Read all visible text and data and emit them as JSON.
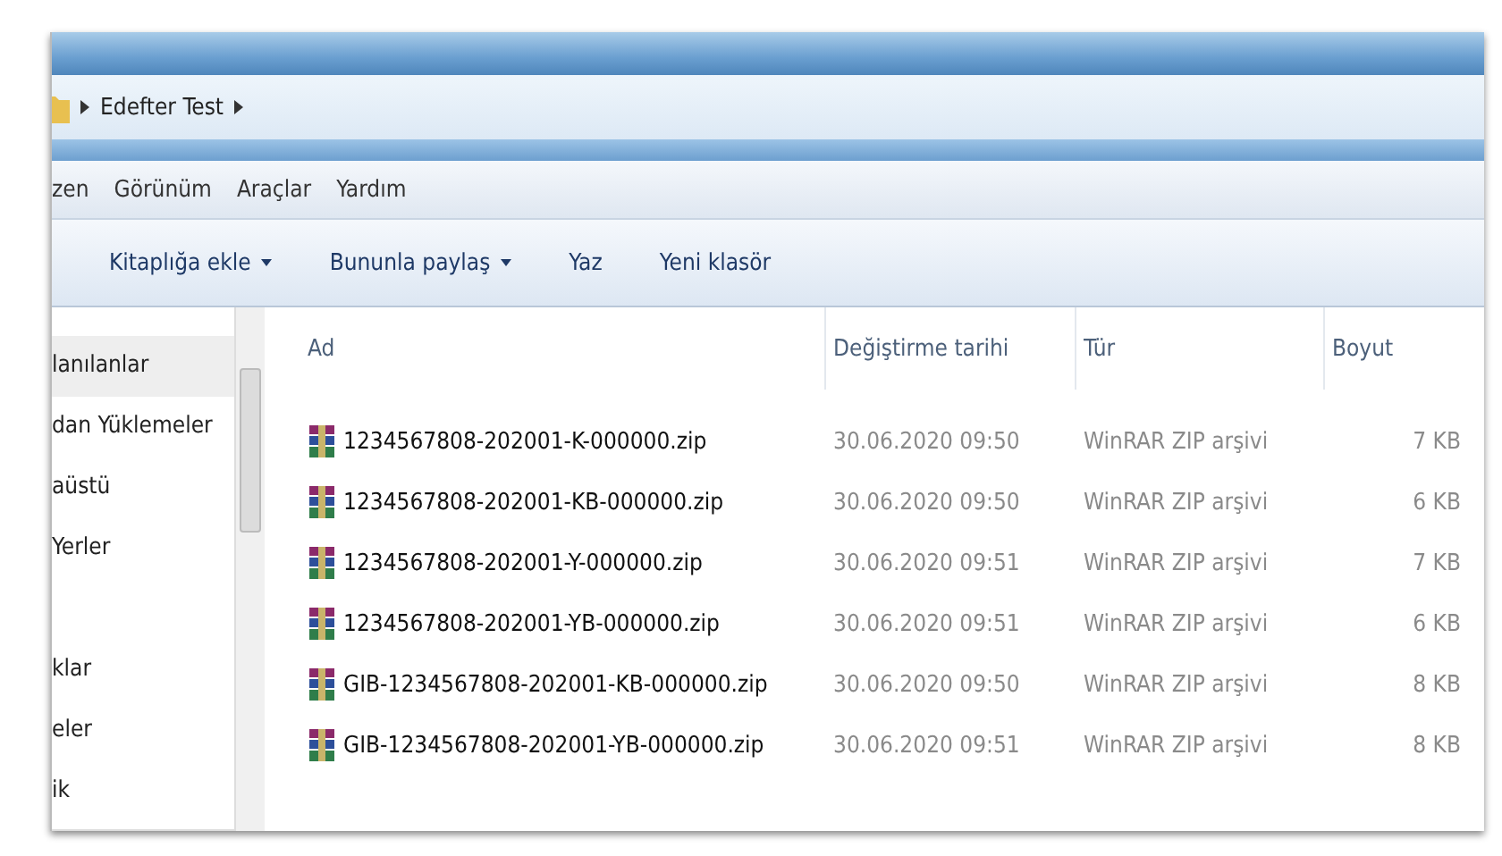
{
  "address_bar": {
    "path": [
      "Edefter Test"
    ]
  },
  "menu_bar": [
    "zen",
    "Görünüm",
    "Araçlar",
    "Yardım"
  ],
  "toolbar": [
    {
      "label": "Kitaplığa ekle",
      "dropdown": true
    },
    {
      "label": "Bununla paylaş",
      "dropdown": true
    },
    {
      "label": "Yaz",
      "dropdown": false
    },
    {
      "label": "Yeni klasör",
      "dropdown": false
    }
  ],
  "sidebar": {
    "groups": [
      {
        "items": [
          {
            "label": "lanılanlar",
            "selected": true
          },
          {
            "label": "dan Yüklemeler",
            "selected": false
          },
          {
            "label": "aüstü",
            "selected": false
          },
          {
            "label": "Yerler",
            "selected": false
          }
        ]
      },
      {
        "items": [
          {
            "label": "klar",
            "selected": false
          },
          {
            "label": "eler",
            "selected": false
          },
          {
            "label": "ik",
            "selected": false
          }
        ]
      }
    ]
  },
  "table": {
    "columns": [
      "Ad",
      "Değiştirme tarihi",
      "Tür",
      "Boyut"
    ],
    "rows": [
      {
        "name": "1234567808-202001-K-000000.zip",
        "modified": "30.06.2020 09:50",
        "type": "WinRAR ZIP arşivi",
        "size": "7 KB"
      },
      {
        "name": "1234567808-202001-KB-000000.zip",
        "modified": "30.06.2020 09:50",
        "type": "WinRAR ZIP arşivi",
        "size": "6 KB"
      },
      {
        "name": "1234567808-202001-Y-000000.zip",
        "modified": "30.06.2020 09:51",
        "type": "WinRAR ZIP arşivi",
        "size": "7 KB"
      },
      {
        "name": "1234567808-202001-YB-000000.zip",
        "modified": "30.06.2020 09:51",
        "type": "WinRAR ZIP arşivi",
        "size": "6 KB"
      },
      {
        "name": "GIB-1234567808-202001-KB-000000.zip",
        "modified": "30.06.2020 09:50",
        "type": "WinRAR ZIP arşivi",
        "size": "8 KB"
      },
      {
        "name": "GIB-1234567808-202001-YB-000000.zip",
        "modified": "30.06.2020 09:51",
        "type": "WinRAR ZIP arşivi",
        "size": "8 KB"
      }
    ]
  }
}
